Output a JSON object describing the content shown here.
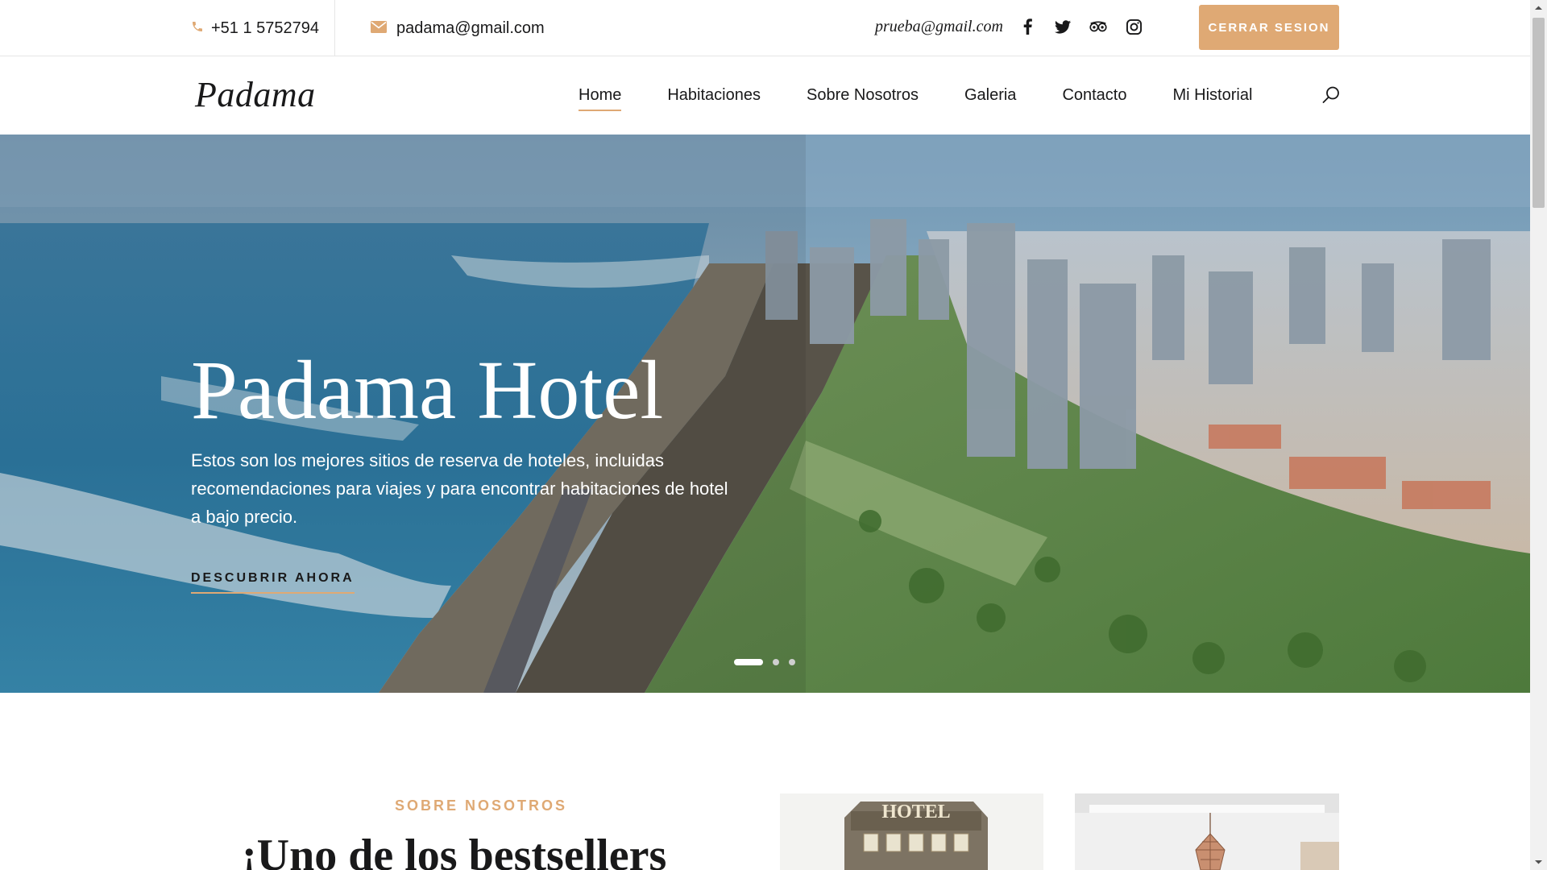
{
  "topbar": {
    "phone": "+51 1 5752794",
    "email": "padama@gmail.com",
    "user_email": "prueba@gmail.com",
    "social_icons": [
      "facebook-icon",
      "twitter-icon",
      "tripadvisor-icon",
      "instagram-icon"
    ],
    "logout_label": "CERRAR SESION"
  },
  "header": {
    "logo": "Padama",
    "nav": [
      {
        "label": "Home",
        "active": true
      },
      {
        "label": "Habitaciones"
      },
      {
        "label": "Sobre Nosotros"
      },
      {
        "label": "Galeria"
      },
      {
        "label": "Contacto"
      },
      {
        "label": "Mi Historial"
      }
    ]
  },
  "hero": {
    "title": "Padama Hotel",
    "text": "Estos son los mejores sitios de reserva de hoteles, incluidas recomendaciones para viajes y para encontrar habitaciones de hotel a bajo precio.",
    "cta": "DESCUBRIR AHORA",
    "slide_count": 3,
    "active_slide": 1
  },
  "about": {
    "subtitle": "SOBRE NOSOTROS",
    "title": "¡Uno de los bestsellers",
    "image_sign": "HOTEL"
  },
  "colors": {
    "accent": "#dfa974",
    "text": "#19191a"
  }
}
